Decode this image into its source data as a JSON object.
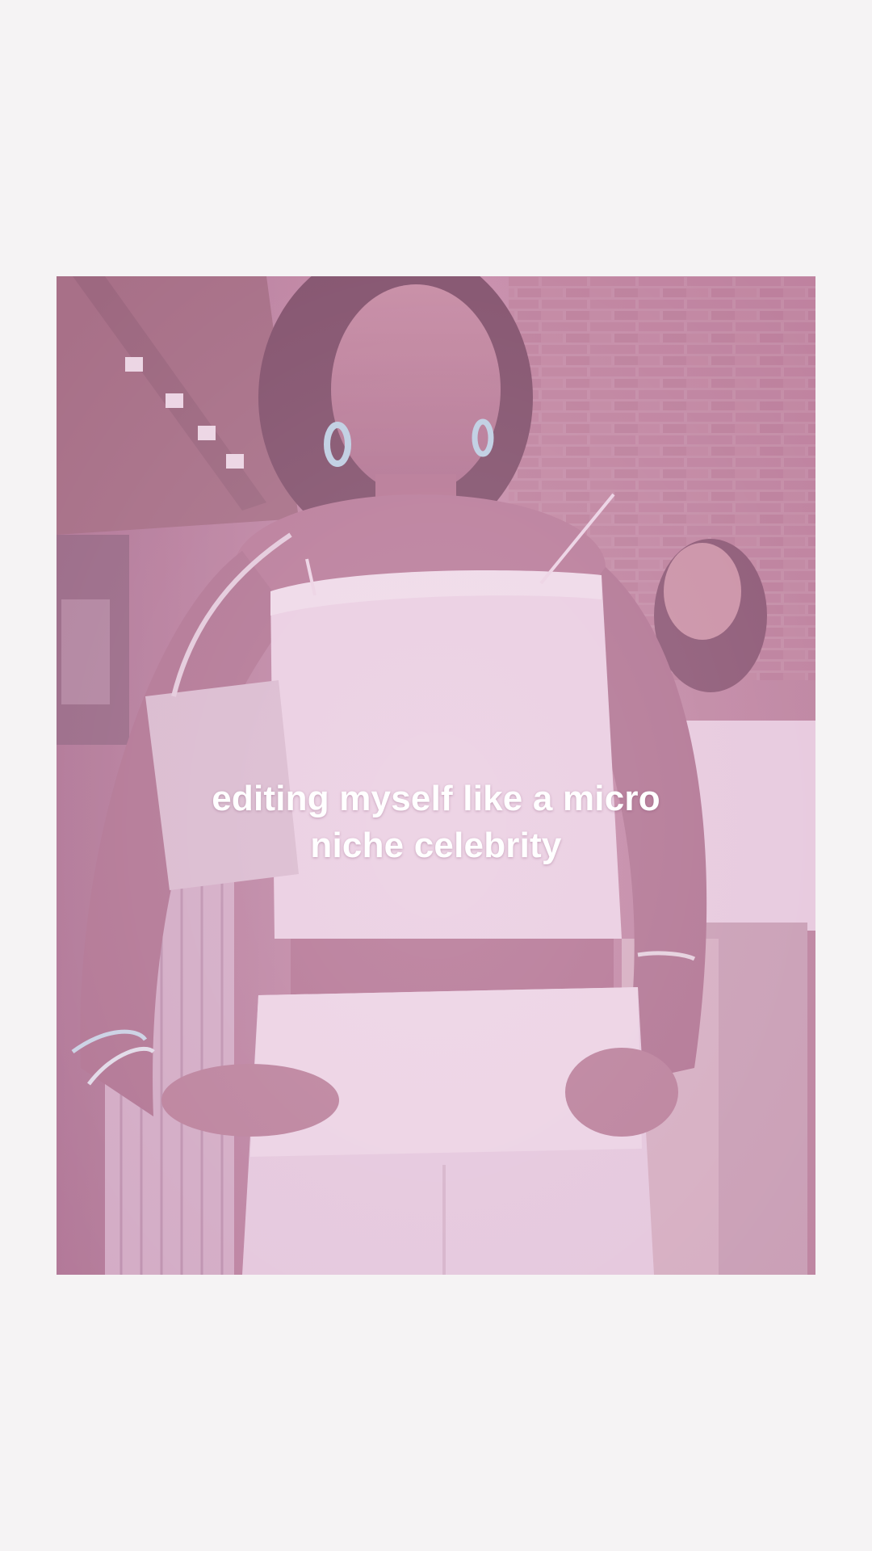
{
  "photo": {
    "description_icon": "photo-of-woman-in-white-outfit",
    "tint_color": "#c98fb8",
    "background_color": "#f5f3f4"
  },
  "caption": {
    "line1": "editing myself like a micro",
    "line2": "niche celebrity"
  }
}
